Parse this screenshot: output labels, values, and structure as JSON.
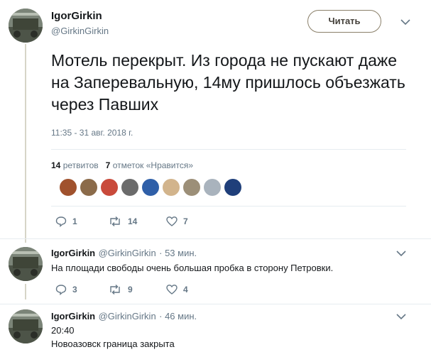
{
  "main_tweet": {
    "display_name": "IgorGirkin",
    "handle": "@GirkinGirkin",
    "follow_label": "Читать",
    "text": "Мотель перекрыт. Из города не пускают даже на Заперевальную, 14му пришлось объезжать через Павших",
    "timestamp": "11:35 - 31 авг. 2018 г.",
    "retweets_count": "14",
    "retweets_label": "ретвитов",
    "likes_count": "7",
    "likes_label": "отметок «Нравится»",
    "actions": {
      "replies": "1",
      "retweets": "14",
      "likes": "7"
    },
    "likers": [
      "#a0522d",
      "#8b6b4a",
      "#c94a3b",
      "#6b6b6b",
      "#2f5fa8",
      "#d2b48c",
      "#9c8f78",
      "#a9b3bd",
      "#1f3f7a"
    ]
  },
  "replies": [
    {
      "display_name": "IgorGirkin",
      "handle": "@GirkinGirkin",
      "time": "· 53 мин.",
      "text": "На площади свободы очень большая пробка в сторону Петровки.",
      "actions": {
        "replies": "3",
        "retweets": "9",
        "likes": "4"
      }
    },
    {
      "display_name": "IgorGirkin",
      "handle": "@GirkinGirkin",
      "time": "· 46 мин.",
      "text_line1": "20:40",
      "text_line2": "Новоазовск граница закрыта"
    }
  ],
  "colors": {
    "accent": "#8a7f69",
    "thread_line": "#d7d5c8",
    "muted": "#657786"
  }
}
